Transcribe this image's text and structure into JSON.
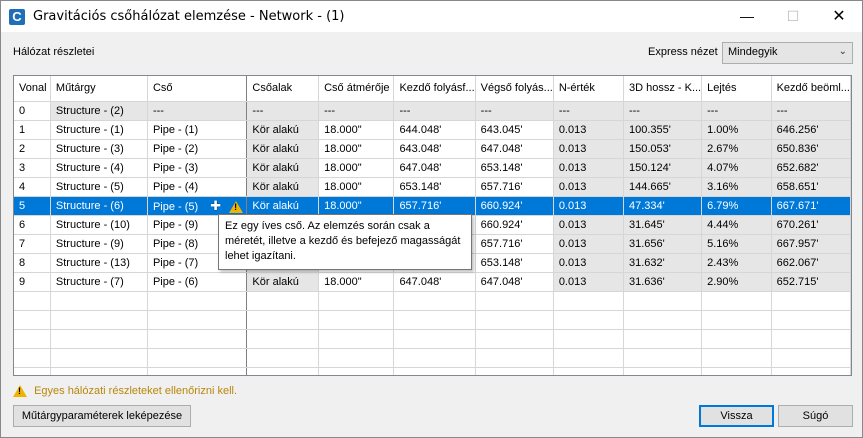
{
  "window": {
    "title": "Gravitációs csőhálózat elemzése - Network - (1)",
    "icon": "civil3d-app-icon",
    "controls": {
      "minimize": "—",
      "maximize": "☐",
      "close": "✕"
    }
  },
  "top": {
    "network_details_label": "Hálózat részletei",
    "express_view_label": "Express nézet",
    "express_view_value": "Mindegyik"
  },
  "table": {
    "columns": [
      "Vonal",
      "Műtárgy",
      "Cső",
      "Csőalak",
      "Cső átmérője",
      "Kezdő folyásf...",
      "Végső folyás...",
      "N-érték",
      "3D hossz - K...",
      "Lejtés",
      "Kezdő beöml..."
    ],
    "rows": [
      [
        "0",
        "Structure - (2)",
        "---",
        "---",
        "---",
        "---",
        "---",
        "---",
        "---",
        "---",
        "---"
      ],
      [
        "1",
        "Structure - (1)",
        "Pipe - (1)",
        "Kör alakú",
        "18.000\"",
        "644.048'",
        "643.045'",
        "0.013",
        "100.355'",
        "1.00%",
        "646.256'"
      ],
      [
        "2",
        "Structure - (3)",
        "Pipe - (2)",
        "Kör alakú",
        "18.000\"",
        "643.048'",
        "647.048'",
        "0.013",
        "150.053'",
        "2.67%",
        "650.836'"
      ],
      [
        "3",
        "Structure - (4)",
        "Pipe - (3)",
        "Kör alakú",
        "18.000\"",
        "647.048'",
        "653.148'",
        "0.013",
        "150.124'",
        "4.07%",
        "652.682'"
      ],
      [
        "4",
        "Structure - (5)",
        "Pipe - (4)",
        "Kör alakú",
        "18.000\"",
        "653.148'",
        "657.716'",
        "0.013",
        "144.665'",
        "3.16%",
        "658.651'"
      ],
      [
        "5",
        "Structure - (6)",
        "Pipe - (5)",
        "Kör alakú",
        "18.000\"",
        "657.716'",
        "660.924'",
        "0.013",
        "47.334'",
        "6.79%",
        "667.671'"
      ],
      [
        "6",
        "Structure - (10)",
        "Pipe - (9)",
        "",
        "",
        "",
        "660.924'",
        "0.013",
        "31.645'",
        "4.44%",
        "670.261'"
      ],
      [
        "7",
        "Structure - (9)",
        "Pipe - (8)",
        "",
        "",
        "",
        "657.716'",
        "0.013",
        "31.656'",
        "5.16%",
        "667.957'"
      ],
      [
        "8",
        "Structure - (13)",
        "Pipe - (7)",
        "",
        "",
        "",
        "653.148'",
        "0.013",
        "31.632'",
        "2.43%",
        "662.067'"
      ],
      [
        "9",
        "Structure - (7)",
        "Pipe - (6)",
        "Kör alakú",
        "18.000\"",
        "647.048'",
        "647.048'",
        "0.013",
        "31.636'",
        "2.90%",
        "652.715'"
      ]
    ],
    "selected_row": 5,
    "warning_row": 5
  },
  "tooltip": {
    "text": "Ez egy íves cső. Az elemzés során csak a méretét, illetve a kezdő és befejező magasságát lehet igazítani."
  },
  "status": {
    "warning_text": "Egyes hálózati részleteket ellenőrizni kell."
  },
  "buttons": {
    "map_params": "Műtárgyparaméterek leképezése",
    "back": "Vissza",
    "help": "Súgó"
  },
  "colors": {
    "selection": "#0078d7",
    "warning": "#f0b400",
    "grey_cell": "#e6e6e6"
  }
}
